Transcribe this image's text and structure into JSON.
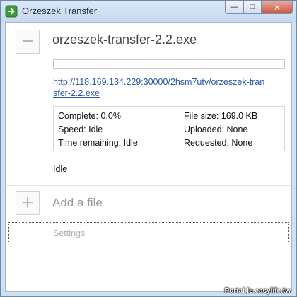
{
  "window": {
    "title": "Orzeszek Transfer",
    "minimize_glyph": "—",
    "maximize_glyph": "□",
    "close_glyph": "✕",
    "app_icon": "green-arrow-icon"
  },
  "file": {
    "remove_glyph": "−",
    "name": "orzeszek-transfer-2.2.exe",
    "progress": 0.0,
    "url": "http://118.169.134.229:30000/2hsm7utv/orzeszek-transfer-2.2.exe",
    "stats": {
      "complete": "Complete: 0.0%",
      "speed": "Speed: Idle",
      "time_remaining": "Time remaining: Idle",
      "file_size": "File size: 169.0 KB",
      "uploaded": "Uploaded: None",
      "requested": "Requested: None"
    },
    "status": "Idle"
  },
  "add": {
    "glyph": "+",
    "label": "Add a file"
  },
  "settings": {
    "label": "Settings"
  },
  "watermark": {
    "text": "Portable.easylife.tw"
  },
  "colors": {
    "link": "#2a56a6",
    "muted": "#9a9a9a",
    "progress_fill": "#4caf50"
  }
}
